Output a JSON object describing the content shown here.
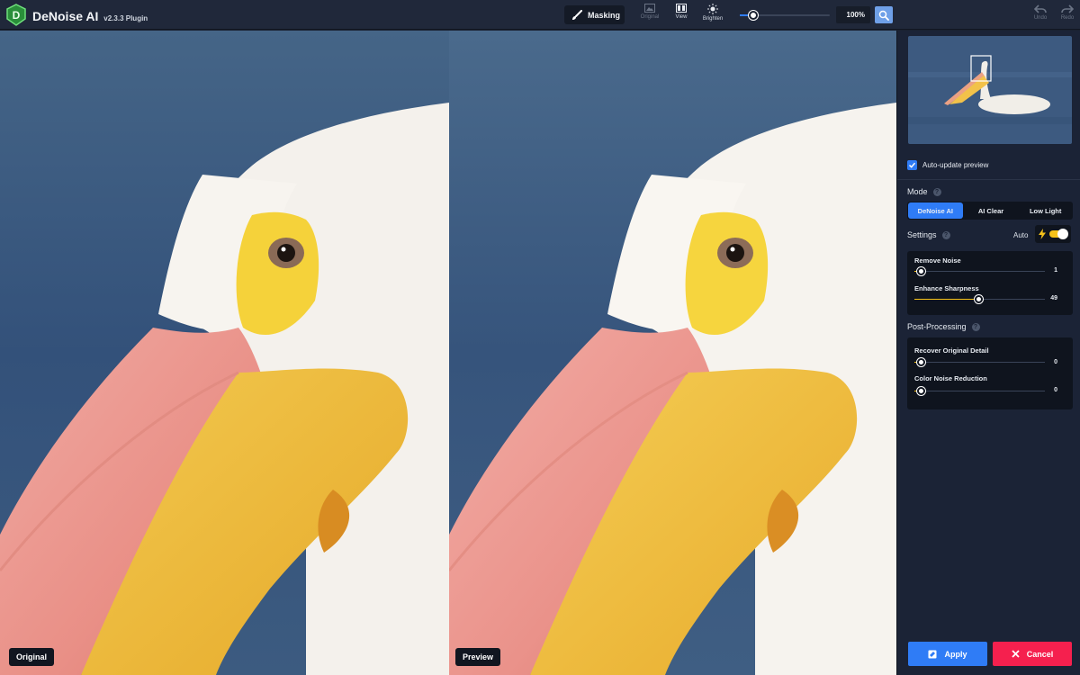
{
  "app": {
    "title": "DeNoise AI",
    "version": "v2.3.3 Plugin"
  },
  "toolbar": {
    "masking_label": "Masking",
    "original_label": "Original",
    "view_label": "View",
    "brighten_label": "Brighten",
    "zoom_value": "100%",
    "zoom_level": 0.05,
    "undo_label": "Undo",
    "redo_label": "Redo"
  },
  "panes": {
    "original_label": "Original",
    "preview_label": "Preview"
  },
  "panel": {
    "auto_update_label": "Auto-update preview",
    "auto_update_checked": true,
    "mode_title": "Mode",
    "modes": [
      "DeNoise AI",
      "AI Clear",
      "Low Light"
    ],
    "active_mode": "DeNoise AI",
    "settings_title": "Settings",
    "auto_label": "Auto",
    "auto_enabled": true,
    "sliders": [
      {
        "label": "Remove Noise",
        "value": "1",
        "fraction": 0.05
      },
      {
        "label": "Enhance Sharpness",
        "value": "49",
        "fraction": 0.49
      }
    ],
    "post_title": "Post-Processing",
    "post_sliders": [
      {
        "label": "Recover Original Detail",
        "value": "0",
        "fraction": 0.05
      },
      {
        "label": "Color Noise Reduction",
        "value": "0",
        "fraction": 0.05
      }
    ],
    "apply_label": "Apply",
    "cancel_label": "Cancel"
  },
  "colors": {
    "accent": "#2f7cf6",
    "slider_active": "#f6c21a",
    "cancel": "#f5204e",
    "panel_bg": "#1b2336"
  }
}
